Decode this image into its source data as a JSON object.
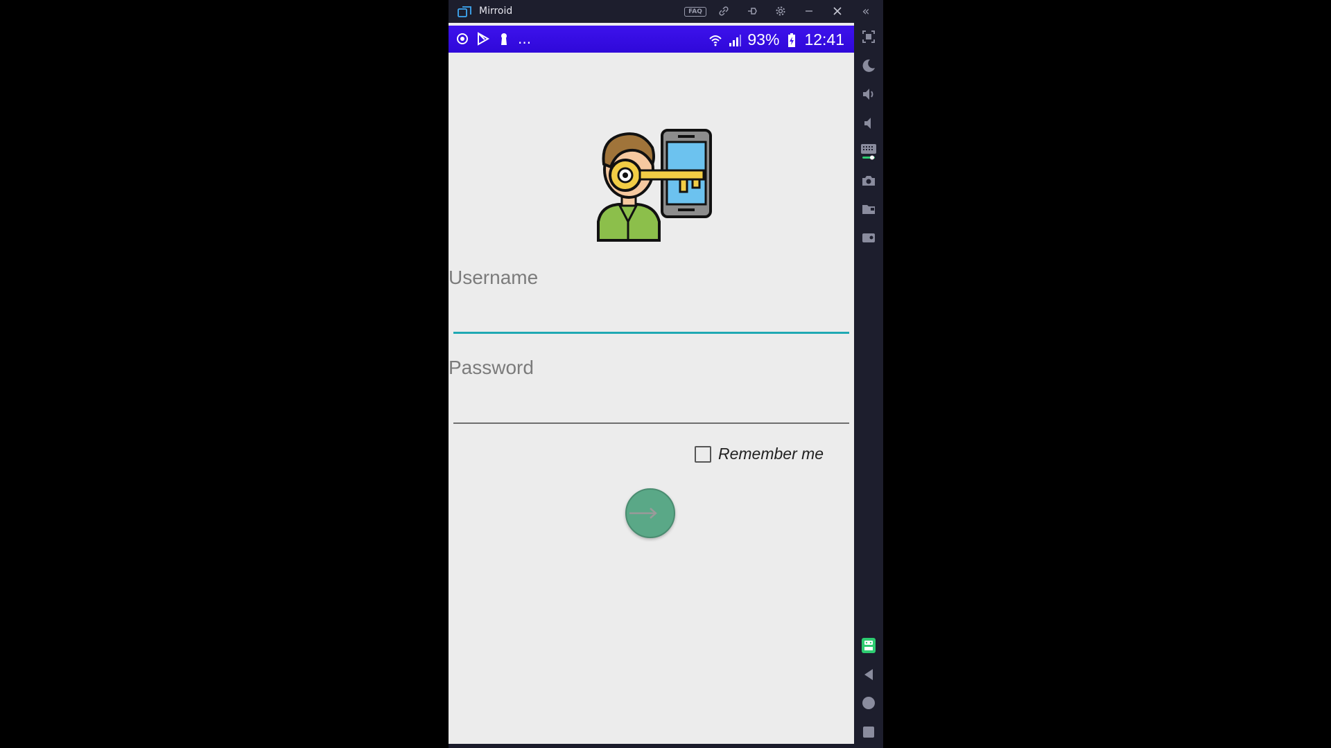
{
  "window": {
    "app_title": "Mirroid",
    "faq_label": "FAQ",
    "collapse_glyph": "«"
  },
  "statusbar": {
    "overflow": "...",
    "battery": "93%",
    "time": "12:41"
  },
  "login": {
    "username_label": "Username",
    "password_label": "Password",
    "remember_label": "Remember me",
    "remember_checked": false
  },
  "colors": {
    "status_bar": "#3d12ec",
    "background": "#ececec",
    "focus_accent": "#1fa8b3",
    "login_button": "#5aa887",
    "window_chrome": "#1d1e2d"
  },
  "icons": {
    "titlebar": [
      "mirroid-logo-icon",
      "faq-icon",
      "link-icon",
      "pin-icon",
      "settings-icon",
      "minimize-icon",
      "close-icon",
      "collapse-icon"
    ],
    "sidebar": [
      "fullscreen-icon",
      "dark-mode-icon",
      "volume-up-icon",
      "volume-down-icon",
      "keyboard-mapping-icon",
      "screenshot-icon",
      "folder-icon",
      "screen-record-icon",
      "ai-assistant-icon",
      "back-icon",
      "home-icon",
      "recents-icon"
    ]
  }
}
